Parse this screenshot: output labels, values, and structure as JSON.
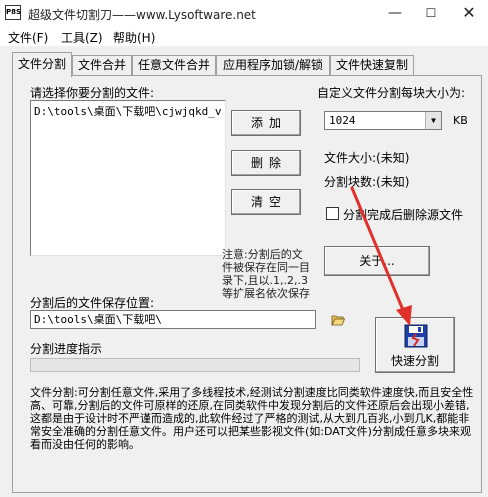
{
  "window": {
    "title": "超级文件切割刀——www.Lysoftware.net",
    "icon_label": "P8S",
    "minimize": "—",
    "maximize": "☐",
    "close": "✕"
  },
  "menu": [
    "文件(F)",
    "工具(Z)",
    "帮助(H)"
  ],
  "tabs": [
    "文件分割",
    "文件合并",
    "任意文件合并",
    "应用程序加锁/解锁",
    "文件快速复制"
  ],
  "split": {
    "select_label": "请选择你要分割的文件:",
    "file_list": [
      "D:\\tools\\桌面\\下载吧\\cjwjqkd_v"
    ],
    "add_button": "添加",
    "delete_button": "删除",
    "clear_button": "清空",
    "note": "注意:分割后的文件被保存在同一目录下,且以.1,.2,.3等扩展名依次保存",
    "chunk_size_label": "自定义文件分割每块大小为:",
    "chunk_size_value": "1024",
    "chunk_unit": "KB",
    "file_size_label": "文件大小:(未知)",
    "chunk_count_label": "分割块数:(未知)",
    "delete_source_label": "分割完成后删除源文件",
    "about_button": "关于...",
    "save_location_label": "分割后的文件保存位置:",
    "save_path": "D:\\tools\\桌面\\下载吧\\",
    "progress_label": "分割进度指示",
    "progress_fraction": 0,
    "split_button": "快速分割",
    "description": "文件分割:可分割任意文件,采用了多线程技术,经测试分割速度比同类软件速度快,而且安全性高、可靠,分割后的文件可原样的还原,在同类软件中发现分割后的文件还原后会出现小差错,这都是由于设计时不严谨而造成的,此软件经过了严格的测试,从大到几百兆,小到几K,都能非常安全准确的分割任意文件。用户还可以把某些影视文件(如:DAT文件)分割成任意多块来观看而没由任何的影响。"
  },
  "colors": {
    "arrow": "#e0302a",
    "panel_bg": "#f0f0f0"
  }
}
